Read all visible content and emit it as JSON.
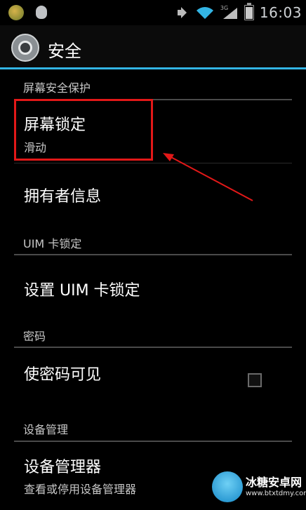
{
  "status_bar": {
    "time": "16:03",
    "network_label": "3G",
    "icons": [
      "app-notification-icon",
      "qq-icon",
      "volume-icon",
      "wifi-icon",
      "signal-icon",
      "battery-icon"
    ],
    "battery_level": 0.85
  },
  "action_bar": {
    "title": "安全",
    "icon": "settings-gear-icon",
    "accent_color": "#33b5e5"
  },
  "sections": {
    "screen_security": {
      "header": "屏幕安全保护",
      "screen_lock": {
        "title": "屏幕锁定",
        "summary": "滑动"
      },
      "owner_info": {
        "title": "拥有者信息"
      }
    },
    "uim_lock": {
      "header": "UIM 卡锁定",
      "setup_uim_lock": {
        "title": "设置 UIM 卡锁定"
      }
    },
    "passwords": {
      "header": "密码",
      "show_passwords": {
        "title": "使密码可见",
        "checked": false
      }
    },
    "device_admin": {
      "header": "设备管理",
      "device_administrators": {
        "title": "设备管理器",
        "summary": "查看或停用设备管理器"
      }
    }
  },
  "annotation": {
    "highlight_color": "#e21818"
  },
  "watermark": {
    "name": "冰糖安卓网",
    "url": "www.btxtdmy.com"
  }
}
